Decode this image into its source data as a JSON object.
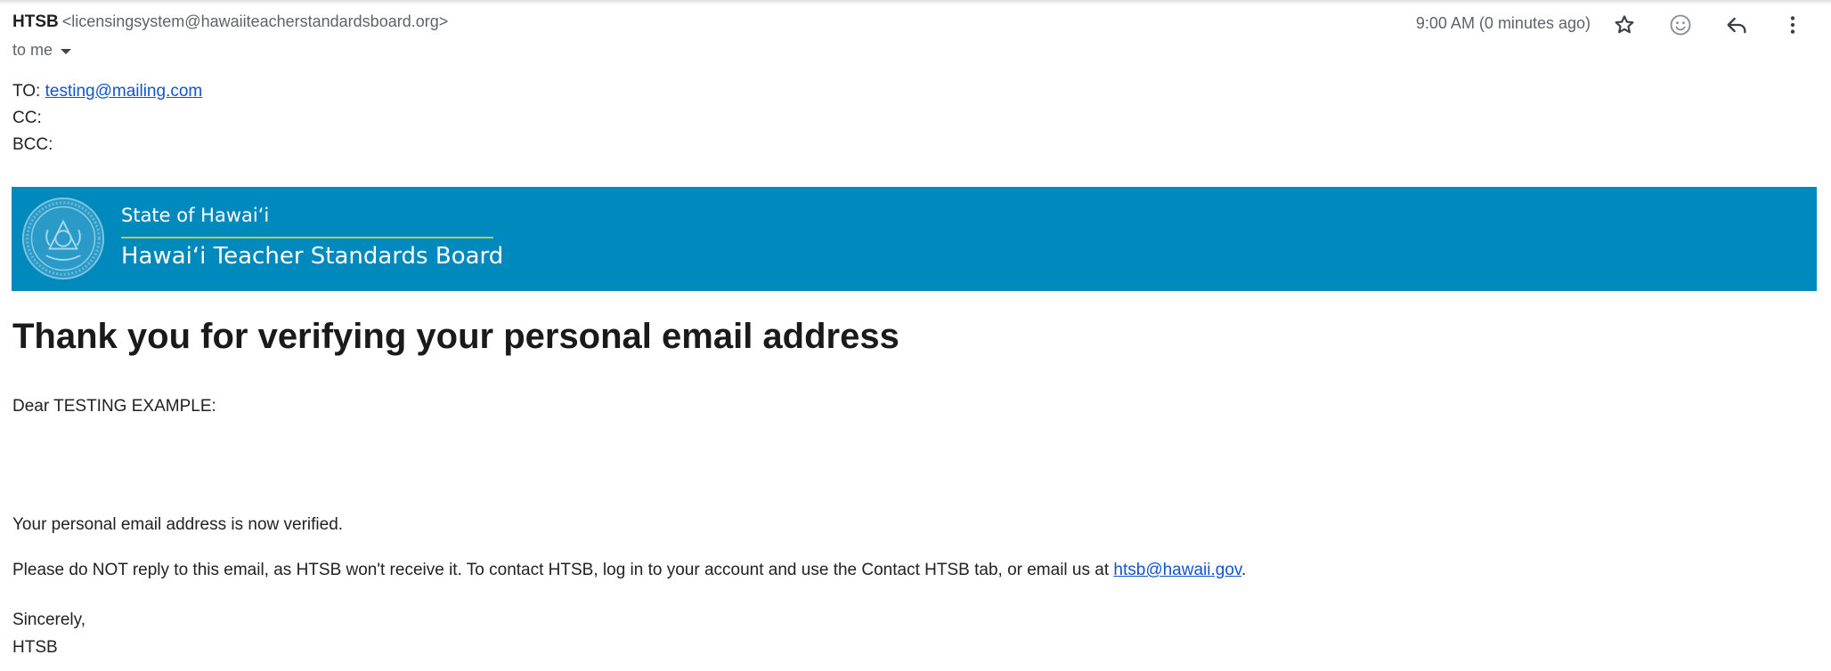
{
  "header": {
    "sender_name": "HTSB",
    "sender_email": "<licensingsystem@hawaiiteacherstandardsboard.org>",
    "recipient_label": "to me",
    "timestamp": "9:00 AM (0 minutes ago)",
    "actions": [
      {
        "name": "star-icon",
        "label": "Star"
      },
      {
        "name": "emoji-icon",
        "label": "Add reaction"
      },
      {
        "name": "reply-icon",
        "label": "Reply"
      },
      {
        "name": "more-vert-icon",
        "label": "More"
      }
    ]
  },
  "addresses": {
    "to_label": "TO:",
    "to_value": "testing@mailing.com",
    "cc_label": "CC:",
    "bcc_label": "BCC:"
  },
  "banner": {
    "line1": "State of Hawaiʻi",
    "line2": "Hawaiʻi Teacher Standards Board",
    "color": "#0089bd",
    "rule_color": "#b7c95e",
    "seal_icon": "state-seal-icon"
  },
  "message": {
    "headline": "Thank you for verifying your personal email address",
    "greeting": "Dear TESTING EXAMPLE:",
    "verified": "Your personal email address is now verified.",
    "notice_prefix": "Please do NOT reply to this email, as HTSB won't receive it. To contact HTSB, log in to your account and use the Contact HTSB tab, or email us at ",
    "notice_link": "htsb@hawaii.gov",
    "notice_suffix": ".",
    "closing": "Sincerely,",
    "signature": "HTSB"
  },
  "colors": {
    "link": "#1155cc",
    "muted": "#5f6368"
  }
}
